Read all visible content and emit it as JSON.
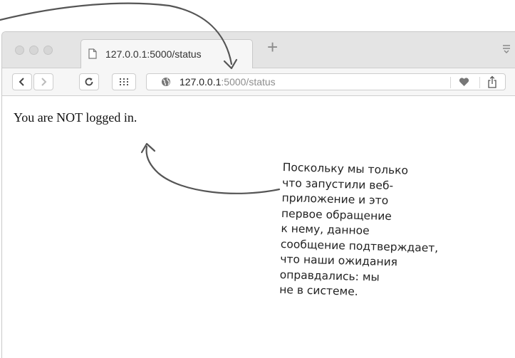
{
  "window": {
    "traffic_lights": [
      "close",
      "minimize",
      "zoom"
    ]
  },
  "tab": {
    "title": "127.0.0.1:5000/status",
    "icon": "page-icon",
    "new_tab_label": "+"
  },
  "toolbar": {
    "back_icon": "chevron-left-icon",
    "forward_icon": "chevron-right-icon",
    "reload_icon": "reload-icon",
    "apps_icon": "apps-grid-icon",
    "site_icon": "globe-icon",
    "url_host": "127.0.0.1",
    "url_rest": ":5000/status",
    "bookmark_icon": "heart-icon",
    "share_icon": "share-icon"
  },
  "page": {
    "message": "You are NOT logged in."
  },
  "annotation": {
    "lines": [
      "Поскольку мы только",
      "что запустили веб-",
      "приложение и это",
      "первое обращение",
      "к нему, данное",
      "сообщение подтверждает,",
      "что наши ожидания",
      "оправдались: мы",
      "не в системе."
    ]
  }
}
